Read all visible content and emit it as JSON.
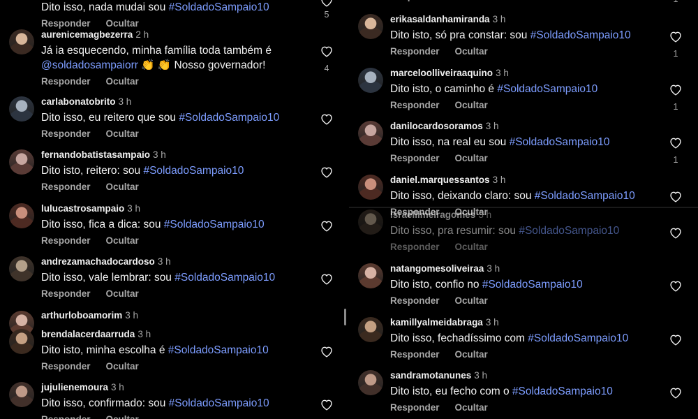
{
  "actions": {
    "reply": "Responder",
    "hide": "Ocultar"
  },
  "left": [
    {
      "author": "",
      "time": "",
      "text": [
        {
          "t": "Dito isso, nada mudai sou "
        },
        {
          "tag": "#SoldadoSampaio10"
        }
      ],
      "likes": "5"
    },
    {
      "author": "aurenicemagbezerra",
      "time": "2 h",
      "text": [
        {
          "t": "Já ia esquecendo, minha família toda também é"
        }
      ],
      "text2": [
        {
          "tag": "@soldadosampaiorr"
        },
        {
          "t": " 👏 👏 Nosso governador!"
        }
      ],
      "likes": "4"
    },
    {
      "author": "carlabonatobrito",
      "time": "3 h",
      "text": [
        {
          "t": "Dito isso, eu reitero que sou "
        },
        {
          "tag": "#SoldadoSampaio10"
        }
      ],
      "likes": ""
    },
    {
      "author": "fernandobatistasampaio",
      "time": "3 h",
      "text": [
        {
          "t": "Dito isto, reitero: sou "
        },
        {
          "tag": "#SoldadoSampaio10"
        }
      ],
      "likes": ""
    },
    {
      "author": "lulucastrosampaio",
      "time": "3 h",
      "text": [
        {
          "t": "Dito isso, fica a dica: sou "
        },
        {
          "tag": "#SoldadoSampaio10"
        }
      ],
      "likes": ""
    },
    {
      "author": "andrezamachadocardoso",
      "time": "3 h",
      "text": [
        {
          "t": "Dito isso, vale lembrar: sou "
        },
        {
          "tag": "#SoldadoSampaio10"
        }
      ],
      "likes": ""
    },
    {
      "author": "arthurloboamorim",
      "time": "3 h",
      "text": [],
      "likes": ""
    },
    {
      "author": "brendalacerdaarruda",
      "time": "3 h",
      "text": [
        {
          "t": "Dito isto, minha escolha é "
        },
        {
          "tag": "#SoldadoSampaio10"
        }
      ],
      "likes": ""
    },
    {
      "author": "jujulienemoura",
      "time": "3 h",
      "text": [
        {
          "t": "Dito isso, confirmado: sou "
        },
        {
          "tag": "#SoldadoSampaio10"
        }
      ],
      "likes": ""
    }
  ],
  "right": [
    {
      "author": "",
      "time": "",
      "text": [],
      "likes": "1"
    },
    {
      "author": "erikasaldanhamiranda",
      "time": "3 h",
      "text": [
        {
          "t": "Dito isto, só pra constar: sou "
        },
        {
          "tag": "#SoldadoSampaio10"
        }
      ],
      "likes": "1"
    },
    {
      "author": "marceloolliveiraaquino",
      "time": "3 h",
      "text": [
        {
          "t": "Dito isto, o caminho é "
        },
        {
          "tag": "#SoldadoSampaio10"
        }
      ],
      "likes": "1"
    },
    {
      "author": "danilocardosoramos",
      "time": "3 h",
      "text": [
        {
          "t": "Dito isso, na real eu sou "
        },
        {
          "tag": "#SoldadoSampaio10"
        }
      ],
      "likes": "1"
    },
    {
      "author": "daniel.marquessantos",
      "time": "3 h",
      "text": [
        {
          "t": "Dito isso, deixando claro: sou "
        },
        {
          "tag": "#SoldadoSampaio10"
        }
      ],
      "likes": ""
    },
    {
      "author": "israellimeiragomes",
      "time": "3 h",
      "text": [
        {
          "t": "Dito isso, pra resumir: sou "
        },
        {
          "tag": "#SoldadoSampaio10"
        }
      ],
      "likes": ""
    },
    {
      "author": "natangomesoliveiraa",
      "time": "3 h",
      "text": [
        {
          "t": "Dito isto, confio no "
        },
        {
          "tag": "#SoldadoSampaio10"
        }
      ],
      "likes": ""
    },
    {
      "author": "kamillyalmeidabraga",
      "time": "3 h",
      "text": [
        {
          "t": "Dito isso, fechadíssimo com "
        },
        {
          "tag": "#SoldadoSampaio10"
        }
      ],
      "likes": ""
    },
    {
      "author": "sandramotanunes",
      "time": "3 h",
      "text": [
        {
          "t": "Dito isto, eu fecho com o "
        },
        {
          "tag": "#SoldadoSampaio10"
        }
      ],
      "likes": ""
    }
  ],
  "colors": {
    "background": "#000000",
    "text": "#f2f2f2",
    "muted": "#a8a8a8",
    "hashtag": "#7d9dff"
  }
}
